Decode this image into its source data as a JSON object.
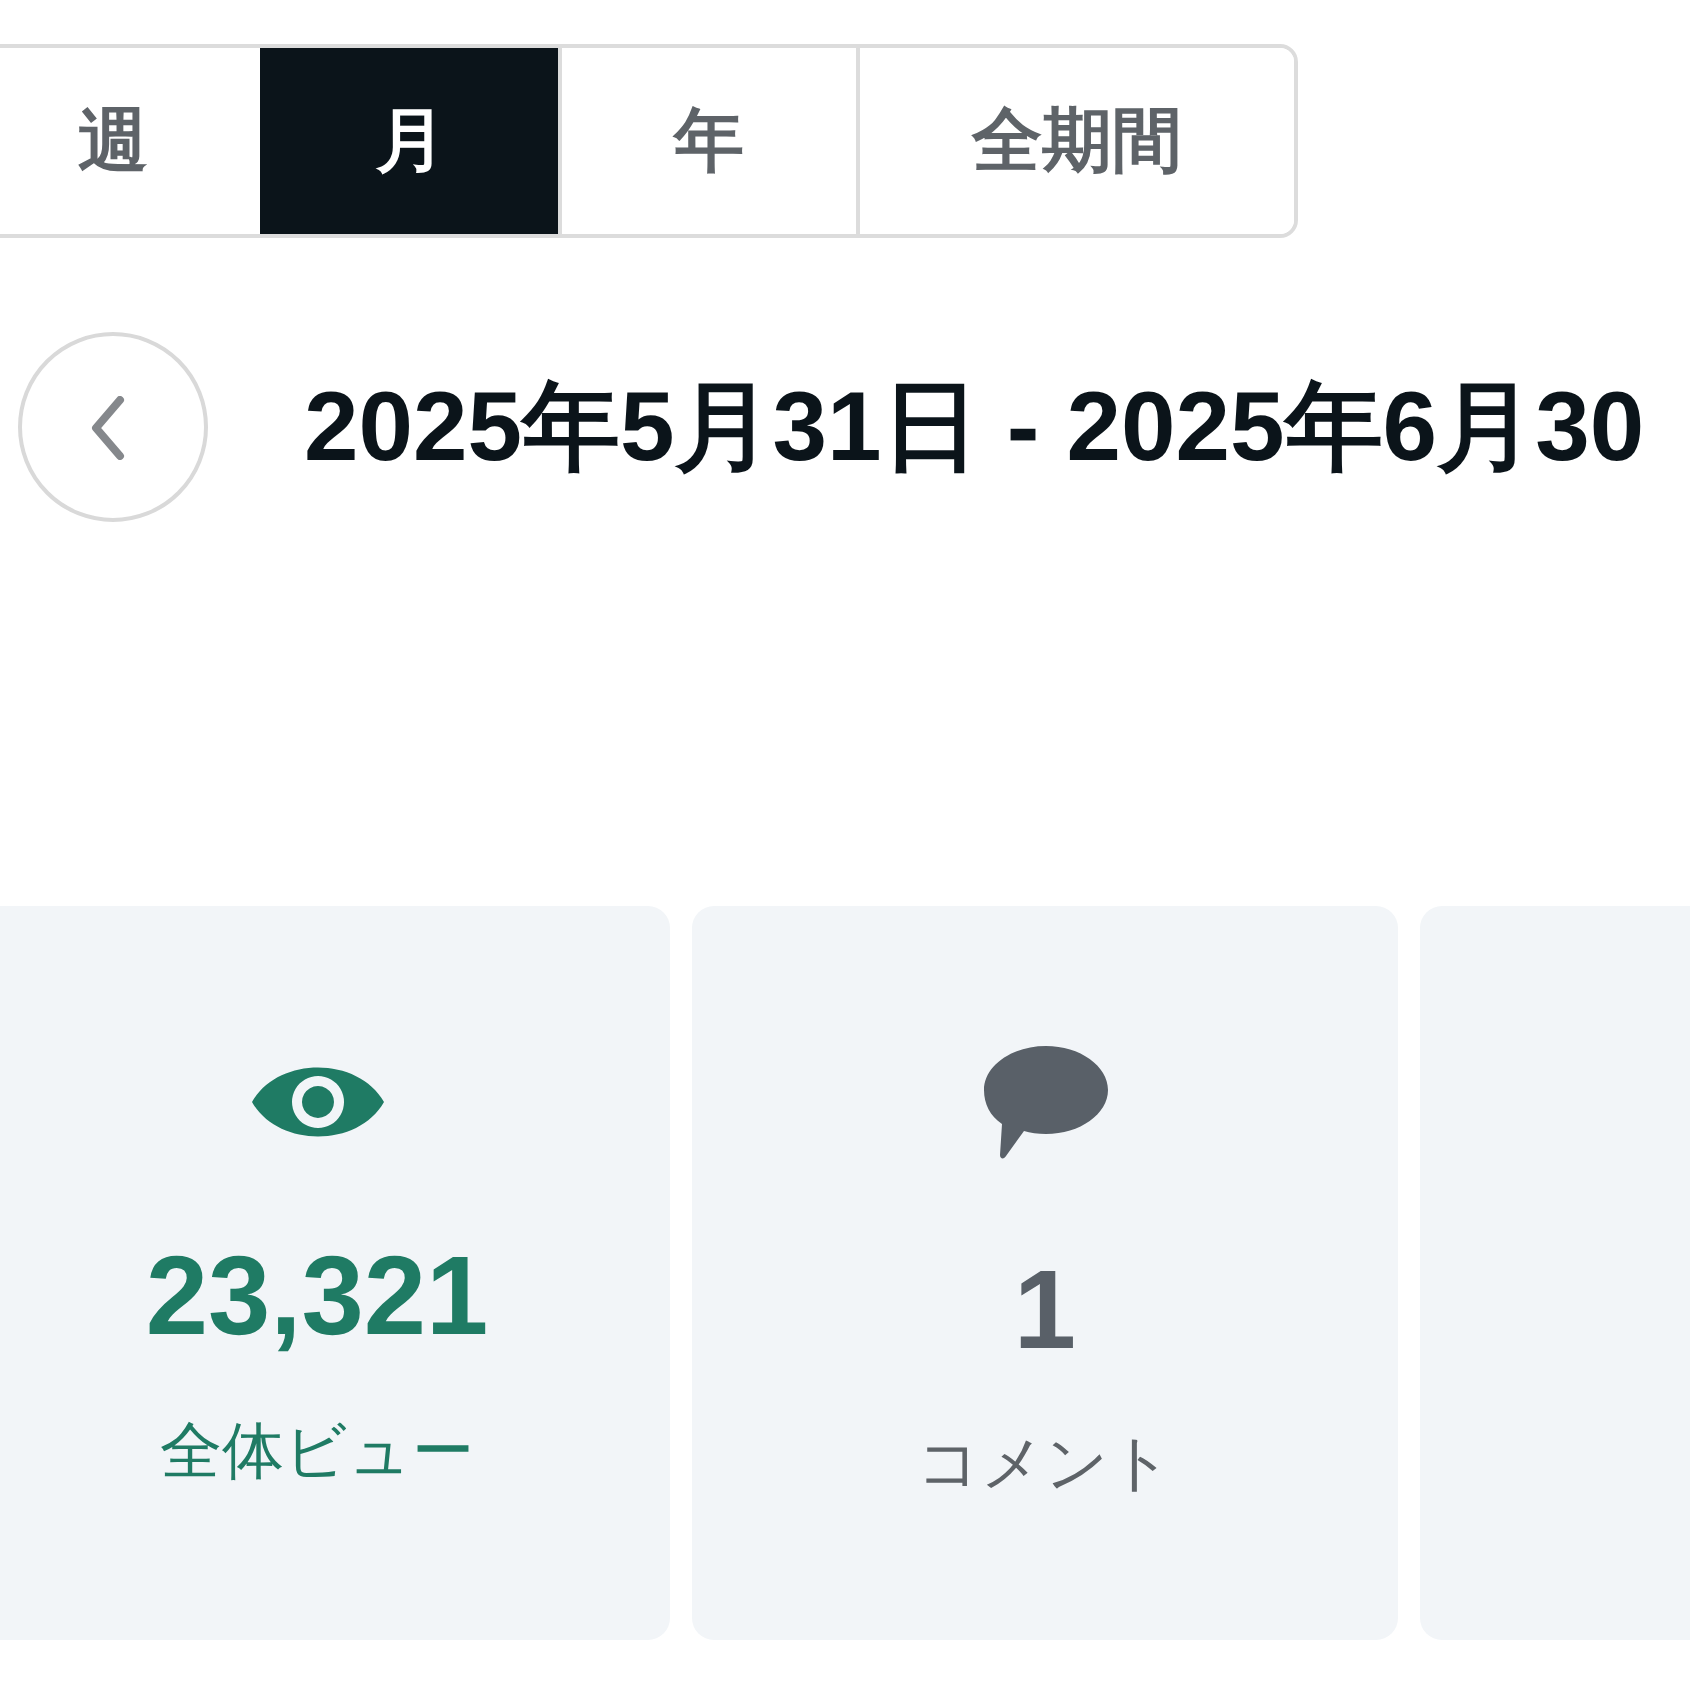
{
  "period_tabs": [
    {
      "label": "週",
      "selected": false
    },
    {
      "label": "月",
      "selected": true
    },
    {
      "label": "年",
      "selected": false
    },
    {
      "label": "全期間",
      "selected": false
    }
  ],
  "date_range": {
    "label": "2025年5月31日 - 2025年6月30"
  },
  "stats": [
    {
      "kind": "views",
      "value": "23,321",
      "label": "全体ビュー"
    },
    {
      "kind": "comments",
      "value": "1",
      "label": "コメント"
    },
    {
      "kind": "clipped"
    }
  ]
}
